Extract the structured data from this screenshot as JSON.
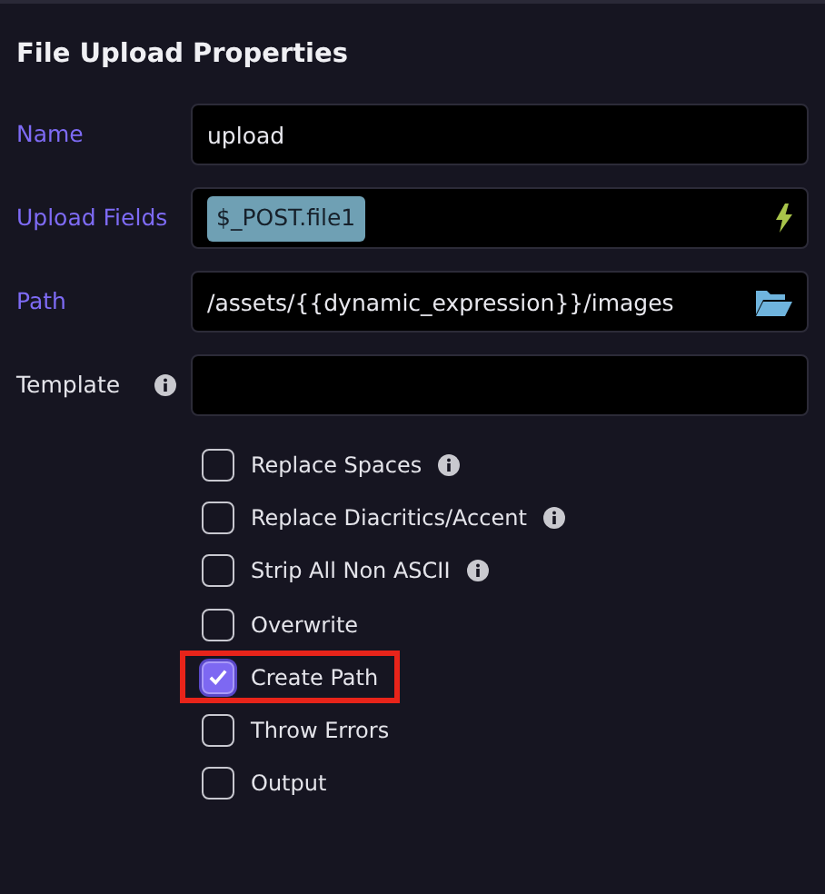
{
  "panel": {
    "title": "File Upload Properties"
  },
  "fields": [
    {
      "label": "Name",
      "dynamic": true,
      "info": false,
      "kind": "text",
      "value": "upload"
    },
    {
      "label": "Upload Fields",
      "dynamic": true,
      "info": false,
      "kind": "tags",
      "tags": [
        "$_POST.file1"
      ]
    },
    {
      "label": "Path",
      "dynamic": true,
      "info": false,
      "kind": "folder",
      "value": "/assets/{{dynamic_expression}}/images"
    },
    {
      "label": "Template",
      "dynamic": false,
      "info": true,
      "kind": "text"
    }
  ],
  "options": [
    {
      "label": "Replace Spaces",
      "checked": false,
      "info": true,
      "highlighted": false
    },
    {
      "label": "Replace Diacritics/Accent",
      "checked": false,
      "info": true,
      "highlighted": false
    },
    {
      "label": "Strip All Non ASCII",
      "checked": false,
      "info": true,
      "highlighted": false
    },
    {
      "label": "Overwrite",
      "checked": false,
      "info": false,
      "highlighted": false
    },
    {
      "label": "Create Path",
      "checked": true,
      "info": false,
      "highlighted": true
    },
    {
      "label": "Throw Errors",
      "checked": false,
      "info": false,
      "highlighted": false
    },
    {
      "label": "Output",
      "checked": false,
      "info": false,
      "highlighted": false
    }
  ]
}
